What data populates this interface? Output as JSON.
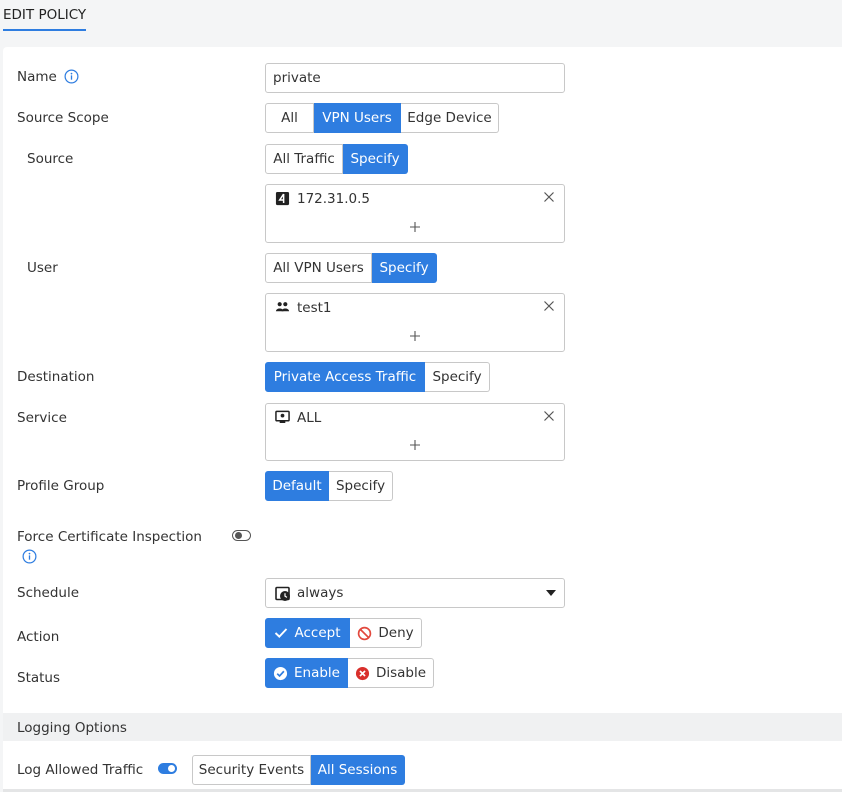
{
  "header": {
    "title": "EDIT POLICY"
  },
  "form": {
    "name": {
      "label": "Name",
      "value": "private"
    },
    "source_scope": {
      "label": "Source Scope",
      "options": [
        "All",
        "VPN Users",
        "Edge Device"
      ],
      "selected": "VPN Users"
    },
    "source": {
      "label": "Source",
      "options": [
        "All Traffic",
        "Specify"
      ],
      "selected": "Specify",
      "entries": [
        {
          "icon": "ipv4-address-icon",
          "text": "172.31.0.5"
        }
      ],
      "add_symbol": "+"
    },
    "user": {
      "label": "User",
      "options": [
        "All VPN Users",
        "Specify"
      ],
      "selected": "Specify",
      "entries": [
        {
          "icon": "user-group-icon",
          "text": "test1"
        }
      ],
      "add_symbol": "+"
    },
    "destination": {
      "label": "Destination",
      "options": [
        "Private Access Traffic",
        "Specify"
      ],
      "selected": "Private Access Traffic"
    },
    "service": {
      "label": "Service",
      "entries": [
        {
          "icon": "service-icon",
          "text": "ALL"
        }
      ],
      "add_symbol": "+"
    },
    "profile_group": {
      "label": "Profile Group",
      "options": [
        "Default",
        "Specify"
      ],
      "selected": "Default"
    },
    "force_cert": {
      "label": "Force Certificate Inspection",
      "enabled": false
    },
    "schedule": {
      "label": "Schedule",
      "value": "always",
      "icon": "schedule-clock-icon"
    },
    "action": {
      "label": "Action",
      "options": [
        "Accept",
        "Deny"
      ],
      "selected": "Accept"
    },
    "status": {
      "label": "Status",
      "options": [
        "Enable",
        "Disable"
      ],
      "selected": "Enable"
    }
  },
  "logging": {
    "section_title": "Logging Options",
    "log_allowed": {
      "label": "Log Allowed Traffic",
      "enabled": true,
      "options": [
        "Security Events",
        "All Sessions"
      ],
      "selected": "All Sessions"
    }
  },
  "colors": {
    "accent": "#2e7de0",
    "deny_red": "#e2483d",
    "disable_red": "#d9302c",
    "border": "#c8c8c8"
  }
}
